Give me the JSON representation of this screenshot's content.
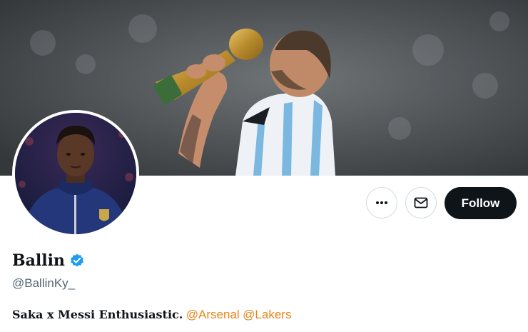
{
  "profile": {
    "display_name": "Ballin",
    "handle": "@BallinKy_",
    "verified": true,
    "bio_text": "Saka x Messi Enthusiastic.",
    "mentions": [
      "@Arsenal",
      "@Lakers"
    ]
  },
  "actions": {
    "more_icon": "more-horizontal-icon",
    "message_icon": "mail-icon",
    "follow_label": "Follow"
  },
  "colors": {
    "accent_mention": "#e8841a",
    "verified_badge": "#1d9bf0",
    "follow_bg": "#0f1419"
  }
}
